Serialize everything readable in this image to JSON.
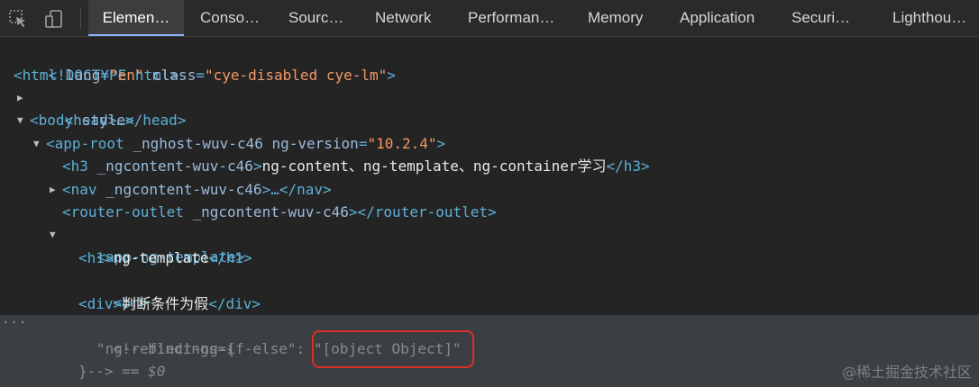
{
  "tabs": [
    {
      "label": "Elemen…",
      "active": true
    },
    {
      "label": "Conso…"
    },
    {
      "label": "Sourc…"
    },
    {
      "label": "Network"
    },
    {
      "label": "Performan…"
    },
    {
      "label": "Memory"
    },
    {
      "label": "Application"
    },
    {
      "label": "Securi…"
    },
    {
      "label": "Lighthou…"
    }
  ],
  "icons": {
    "inspect": "inspect-element-icon",
    "device": "device-toolbar-icon"
  },
  "tree": {
    "doctype": "<!DOCTYPE html>",
    "html": {
      "open": "<",
      "tag": "html",
      "a1": "lang",
      "v1": "\"en\"",
      "a2": "class",
      "v2": "\"cye-disabled cye-lm\"",
      "close": ">"
    },
    "head": {
      "text": "<head>…</head>"
    },
    "body": {
      "tag": "<body",
      "attr": "style",
      "close": ">"
    },
    "approot": {
      "tag": "<app-root",
      "a1": "_nghost-wuv-c46",
      "a2": "ng-version",
      "v2": "\"10.2.4\"",
      "close": ">"
    },
    "h3": {
      "open": "<h3",
      "attr": "_ngcontent-wuv-c46",
      "gt": ">",
      "text": "ng-content、ng-template、ng-container学习",
      "end": "</h3>"
    },
    "nav": {
      "open": "<nav",
      "attr": "_ngcontent-wuv-c46",
      "rest": ">…</nav>"
    },
    "router": {
      "open": "<router-outlet",
      "attr": "_ngcontent-wuv-c46",
      "rest": "></router-outlet>"
    },
    "appng": {
      "text": "<app-ng-template>"
    },
    "h1": {
      "open": "<h1>",
      "text": "ng-template",
      "end": "</h1>"
    },
    "br": {
      "text": "<br>"
    },
    "div": {
      "open": "<div>",
      "text": "判断条件为假",
      "end": "</div>"
    },
    "comment": {
      "l1": "<!--bindings={",
      "l2key": "\"ng-reflect-ng-if-else\"",
      "l2colon": ": ",
      "l2val": "\"[object Object]\"",
      "l3": "}-->",
      "eq": " == ",
      "dollar": "$0"
    },
    "dots": "···"
  },
  "watermark": "@稀土掘金技术社区",
  "colors": {
    "background": "#242424",
    "tag": "#5db0d7",
    "attribute": "#9bbbdc",
    "attribute_value": "#f29766",
    "highlight": "#3b3f44",
    "annotation": "#d93025"
  }
}
